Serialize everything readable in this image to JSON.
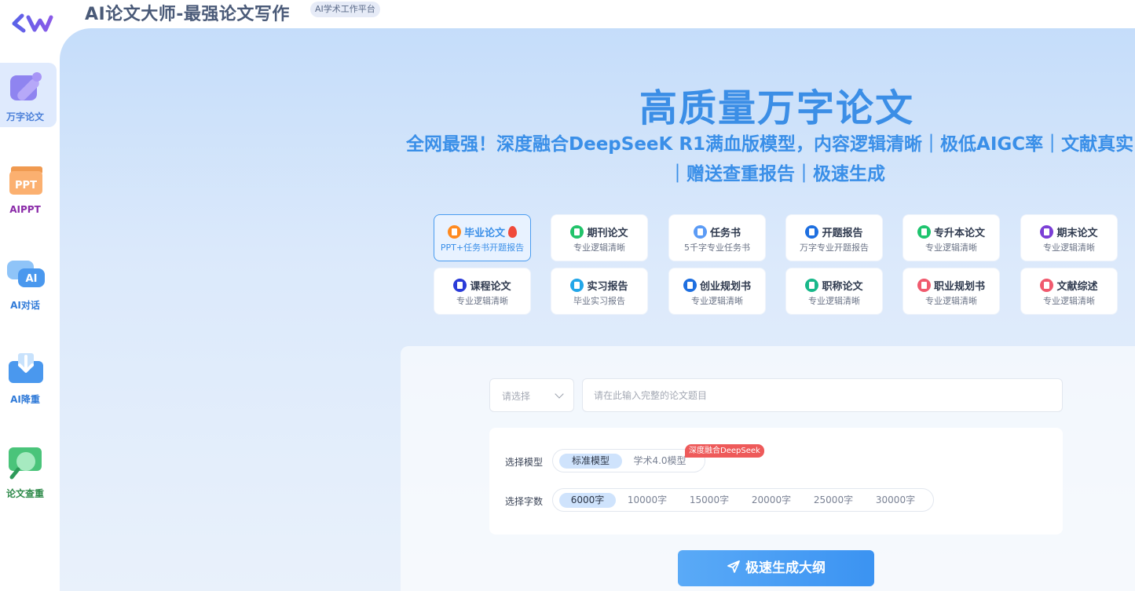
{
  "header": {
    "logo_text": "LW",
    "title": "AI论文大师-最强论文写作",
    "badge": "AI学术工作平台"
  },
  "sidebar": {
    "items": [
      {
        "label": "万字论文",
        "icon": "pencil-icon",
        "color": "#4a7fd8",
        "active": true
      },
      {
        "label": "AIPPT",
        "icon": "ppt-icon",
        "color": "#8a2aa8",
        "active": false
      },
      {
        "label": "AI对话",
        "icon": "chat-icon",
        "color": "#2f7ad8",
        "active": false
      },
      {
        "label": "AI降重",
        "icon": "download-icon",
        "color": "#2f7ad8",
        "active": false
      },
      {
        "label": "论文查重",
        "icon": "magnifier-icon",
        "color": "#2e8a4a",
        "active": false
      }
    ]
  },
  "hero": {
    "title": "高质量万字论文",
    "subtitle_line1": "全网最强！深度融合DeepSeeK R1满血版模型，内容逻辑清晰｜极低AIGC率｜文献真实",
    "subtitle_line2": "｜赠送查重报告｜极速生成"
  },
  "cards": [
    {
      "title": "毕业论文",
      "desc": "PPT+任务书开题报告",
      "color": "#ff8a1f",
      "active": true
    },
    {
      "title": "期刊论文",
      "desc": "专业逻辑清晰",
      "color": "#22c36a"
    },
    {
      "title": "任务书",
      "desc": "5千字专业任务书",
      "color": "#5b9bf5"
    },
    {
      "title": "开题报告",
      "desc": "万字专业开题报告",
      "color": "#1e6fe0"
    },
    {
      "title": "专升本论文",
      "desc": "专业逻辑清晰",
      "color": "#1ec46e"
    },
    {
      "title": "期末论文",
      "desc": "专业逻辑清晰",
      "color": "#7b3fd6"
    },
    {
      "title": "课程论文",
      "desc": "专业逻辑清晰",
      "color": "#2a3bd8"
    },
    {
      "title": "实习报告",
      "desc": "毕业实习报告",
      "color": "#22a6e8"
    },
    {
      "title": "创业规划书",
      "desc": "专业逻辑清晰",
      "color": "#1e6fe0"
    },
    {
      "title": "职称论文",
      "desc": "专业逻辑清晰",
      "color": "#18b88a"
    },
    {
      "title": "职业规划书",
      "desc": "专业逻辑清晰",
      "color": "#f05a6e"
    },
    {
      "title": "文献综述",
      "desc": "专业逻辑清晰",
      "color": "#f05a6e"
    }
  ],
  "form": {
    "select_placeholder": "请选择",
    "title_placeholder": "请在此输入完整的论文题目",
    "model_label": "选择模型",
    "models": [
      "标准模型",
      "学术4.0模型"
    ],
    "selected_model": "标准模型",
    "deepseek_badge": "深度融合DeepSeek",
    "words_label": "选择字数",
    "word_counts": [
      "6000字",
      "10000字",
      "15000字",
      "20000字",
      "25000字",
      "30000字"
    ],
    "selected_words": "6000字",
    "submit_label": "极速生成大纲"
  }
}
